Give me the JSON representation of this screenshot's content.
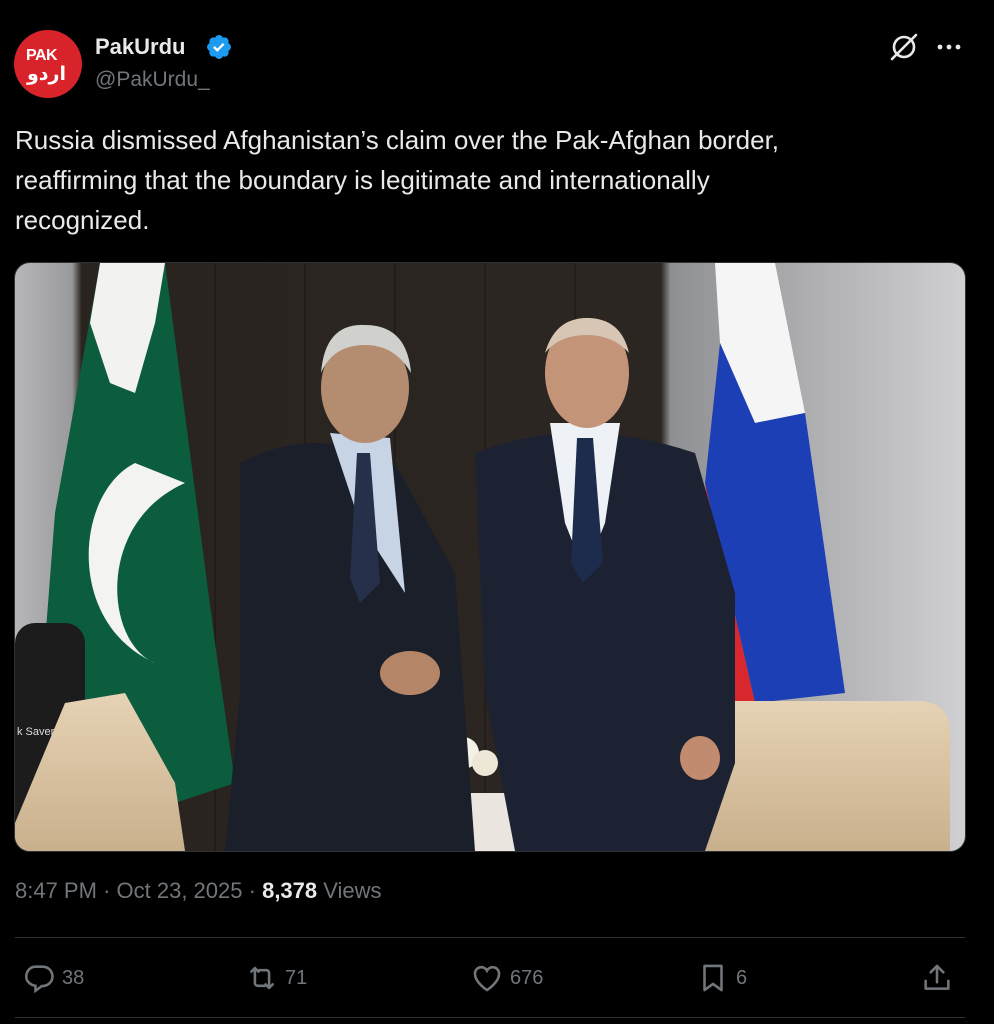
{
  "author": {
    "avatar_text_top": "PAK",
    "avatar_text_urdu": "اردو",
    "display_name": "PakUrdu",
    "handle": "@PakUrdu_",
    "verified": true
  },
  "header_icons": [
    "grok-icon",
    "more-icon"
  ],
  "tweet": {
    "text": "Russia dismissed Afghanistan’s claim over the Pak-Afghan border,\nreaffirming that the boundary is legitimate and internationally\nrecognized."
  },
  "media": {
    "description_icon": "photo",
    "chair_label": "k Saver"
  },
  "meta": {
    "time": "8:47 PM",
    "separator": "·",
    "date": "Oct 23, 2025",
    "views_count": "8,378",
    "views_label": "Views"
  },
  "actions": {
    "replies": "38",
    "reposts": "71",
    "likes": "676",
    "bookmarks": "6"
  },
  "colors": {
    "background": "#000000",
    "text": "#e7e9ea",
    "secondary": "#71767b",
    "verified": "#1d9bf0",
    "avatar": "#d8232a"
  }
}
